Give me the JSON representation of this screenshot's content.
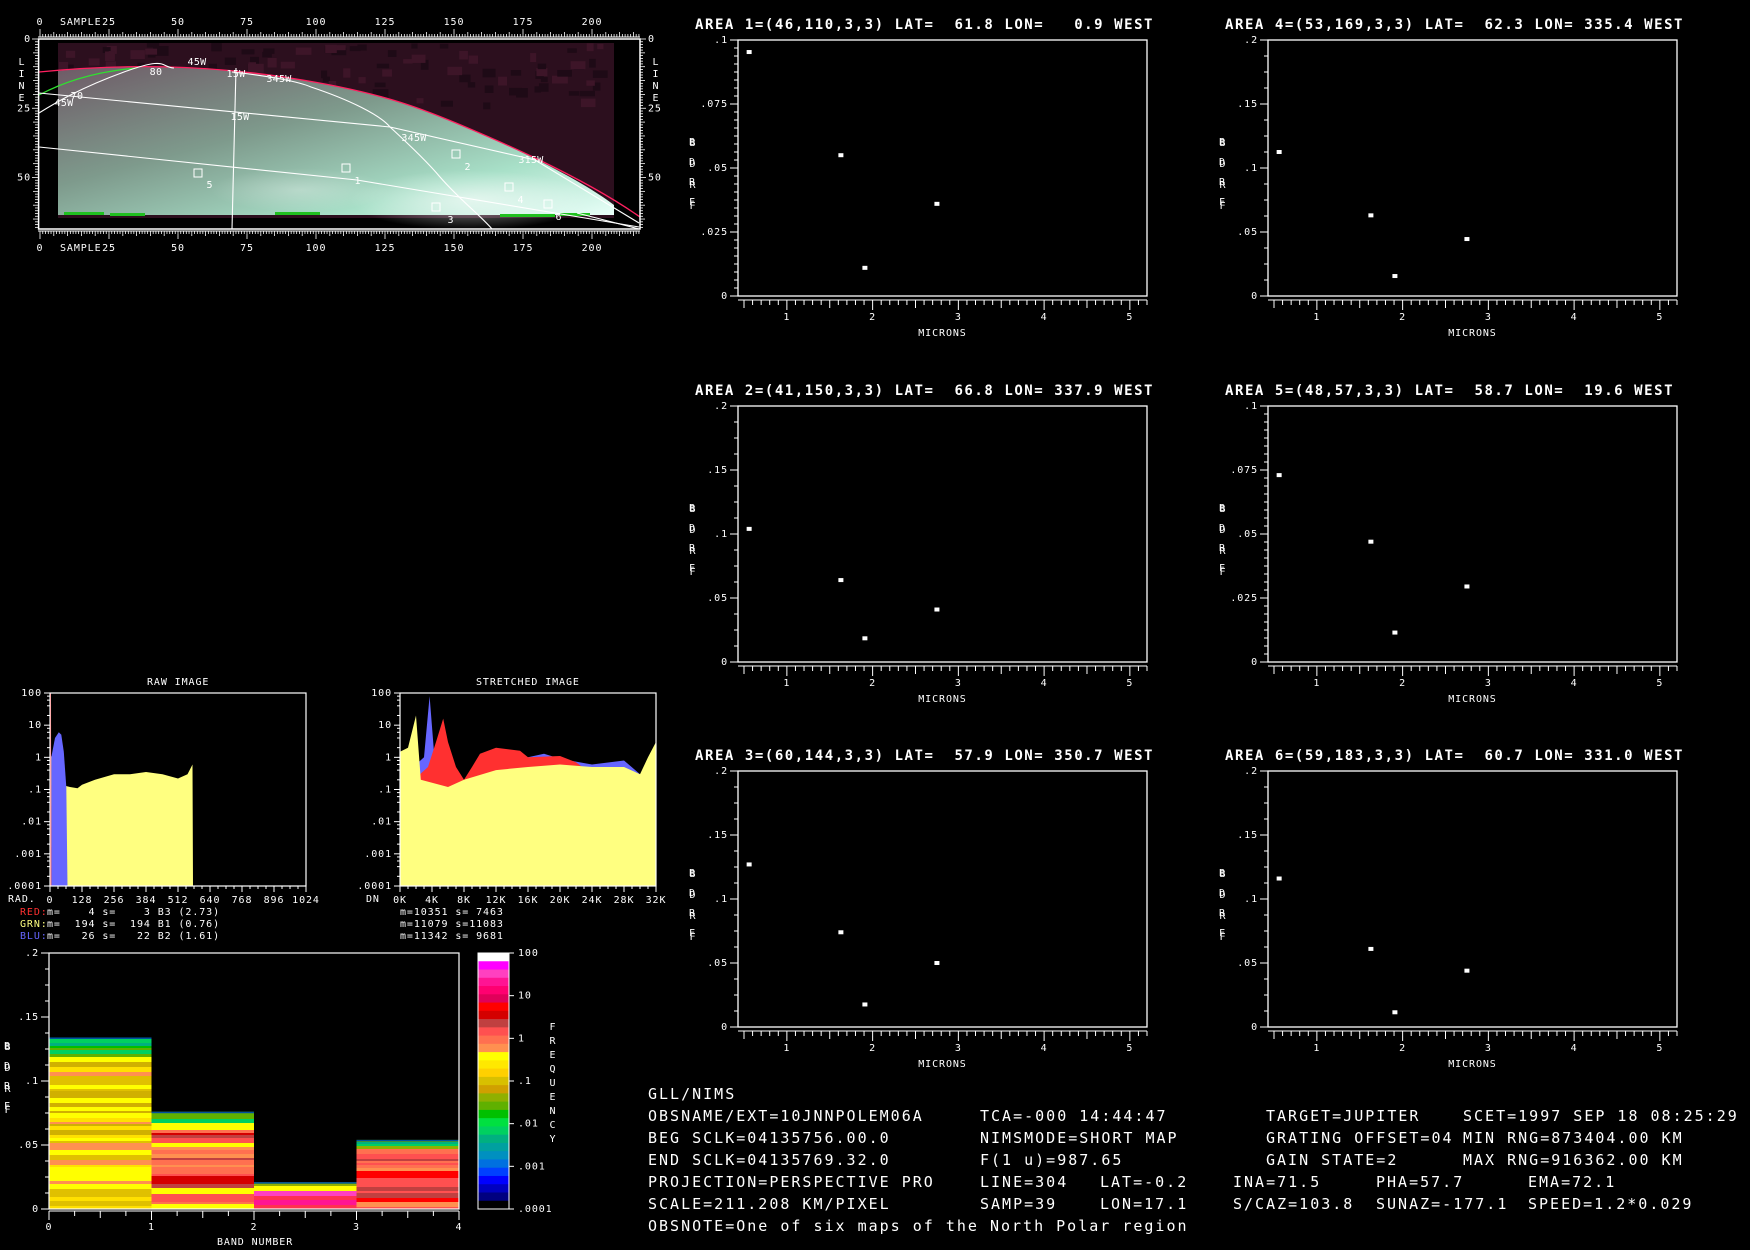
{
  "map": {
    "sample_axis_label": "SAMPLE",
    "line_axis_label": [
      "L",
      "I",
      "N",
      "E"
    ],
    "sample_ticks": [
      "0",
      "25",
      "50",
      "75",
      "100",
      "125",
      "150",
      "175",
      "200"
    ],
    "line_ticks": [
      "0",
      "25",
      "50"
    ],
    "grid_labels": [
      "80",
      "45W",
      "15W",
      "345W",
      "70",
      "45W",
      "15W",
      "345W",
      "315W"
    ],
    "area_labels": [
      "1",
      "2",
      "3",
      "4",
      "5",
      "6"
    ]
  },
  "histograms": {
    "raw": {
      "title": "RAW IMAGE",
      "x_unit": "RAD.",
      "xticks": [
        "0",
        "128",
        "256",
        "384",
        "512",
        "640",
        "768",
        "896",
        "1024"
      ],
      "yticks": [
        "100",
        "10",
        "1",
        ".1",
        ".01",
        ".001",
        ".0001"
      ],
      "stats": [
        {
          "label": "RED:",
          "text": "m=    4 s=    3 B3 (2.73)",
          "color": "#ff3030"
        },
        {
          "label": "GRN:",
          "text": "m=  194 s=  194 B1 (0.76)",
          "color": "#ffff80"
        },
        {
          "label": "BLU:",
          "text": "m=   26 s=   22 B2 (1.61)",
          "color": "#6666ff"
        }
      ]
    },
    "stretched": {
      "title": "STRETCHED IMAGE",
      "x_unit": "DN",
      "xticks": [
        "0K",
        "4K",
        "8K",
        "12K",
        "16K",
        "20K",
        "24K",
        "28K",
        "32K"
      ],
      "yticks": [
        "100",
        "10",
        "1",
        ".1",
        ".01",
        ".001",
        ".0001"
      ],
      "stats": [
        "m=10351 s= 7463",
        "m=11079 s=11083",
        "m=11342 s= 9681"
      ]
    }
  },
  "band_chart": {
    "yticks": [
      ".2",
      ".15",
      ".1",
      ".05",
      "0"
    ],
    "xticks": [
      "0",
      "1",
      "2",
      "3",
      "4"
    ],
    "xlabel": "BAND NUMBER",
    "ylabel": [
      "B",
      "D",
      "R",
      "F"
    ],
    "colorbar_ticks": [
      "100",
      "10",
      "1",
      ".1",
      ".01",
      ".001",
      ".0001"
    ],
    "colorbar_label": [
      "F",
      "R",
      "E",
      "Q",
      "U",
      "E",
      "N",
      "C",
      "Y"
    ]
  },
  "areas": [
    {
      "title": "AREA 1=(46,110,3,3) LAT=  61.8 LON=   0.9 WEST",
      "yticks": [
        ".1",
        ".075",
        ".05",
        ".025",
        "0"
      ]
    },
    {
      "title": "AREA 2=(41,150,3,3) LAT=  66.8 LON= 337.9 WEST",
      "yticks": [
        ".2",
        ".15",
        ".1",
        ".05",
        "0"
      ]
    },
    {
      "title": "AREA 3=(60,144,3,3) LAT=  57.9 LON= 350.7 WEST",
      "yticks": [
        ".2",
        ".15",
        ".1",
        ".05",
        "0"
      ]
    },
    {
      "title": "AREA 4=(53,169,3,3) LAT=  62.3 LON= 335.4 WEST",
      "yticks": [
        ".2",
        ".15",
        ".1",
        ".05",
        "0"
      ]
    },
    {
      "title": "AREA 5=(48,57,3,3) LAT=  58.7 LON=  19.6 WEST",
      "yticks": [
        ".1",
        ".075",
        ".05",
        ".025",
        "0"
      ]
    },
    {
      "title": "AREA 6=(59,183,3,3) LAT=  60.7 LON= 331.0 WEST",
      "yticks": [
        ".2",
        ".15",
        ".1",
        ".05",
        "0"
      ]
    }
  ],
  "area_axis": {
    "xlabel": "MICRONS",
    "ylabel": [
      "B",
      "D",
      "R",
      "F"
    ],
    "xticks": [
      "1",
      "2",
      "3",
      "4",
      "5"
    ]
  },
  "info": {
    "header": "GLL/NIMS",
    "obsname": "OBSNAME/EXT=10JNNPOLEM06A",
    "tca": "TCA=-000 14:44:47",
    "target": "TARGET=JUPITER",
    "scet": "SCET=1997 SEP 18 08:25:29",
    "beg_sclk": "BEG SCLK=04135756.00.0",
    "nimsmode": "NIMSMODE=SHORT MAP",
    "grating": "GRATING OFFSET=04",
    "min_rng": "MIN RNG=873404.00 KM",
    "end_sclk": "END SCLK=04135769.32.0",
    "f1u": "F(1 u)=987.65",
    "gain": "GAIN STATE=2",
    "max_rng": "MAX RNG=916362.00 KM",
    "projection": "PROJECTION=PERSPECTIVE PRO",
    "line": "LINE=304",
    "lat": "LAT=-0.2",
    "ina": "INA=71.5",
    "pha": "PHA=57.7",
    "ema": "EMA=72.1",
    "scale": "SCALE=211.208 KM/PIXEL",
    "samp": "SAMP=39",
    "lon": "LON=17.1",
    "scaz": "S/CAZ=103.8",
    "sunaz": "SUNAZ=-177.1",
    "speed": "SPEED=1.2*0.029",
    "obsnote": "OBSNOTE=One of six maps of the North Polar region"
  },
  "colors": {
    "red": "#ff3030",
    "yellow": "#ffff80",
    "blue": "#6666ff",
    "limb": "#ff2060",
    "terminator": "#30e030"
  },
  "chart_data": [
    {
      "type": "scatter",
      "title": "AREA 1=(46,110,3,3) LAT=  61.8 LON=   0.9 WEST",
      "xlabel": "MICRONS",
      "ylabel": "BDRF",
      "xlim": [
        0.43,
        5.2
      ],
      "ylim": [
        0,
        0.1
      ],
      "x": [
        0.56,
        1.63,
        1.91,
        2.75
      ],
      "y": [
        0.0953,
        0.055,
        0.011,
        0.036
      ]
    },
    {
      "type": "scatter",
      "title": "AREA 2=(41,150,3,3) LAT=  66.8 LON= 337.9 WEST",
      "xlabel": "MICRONS",
      "ylabel": "BDRF",
      "xlim": [
        0.43,
        5.2
      ],
      "ylim": [
        0,
        0.2
      ],
      "x": [
        0.56,
        1.63,
        1.91,
        2.75
      ],
      "y": [
        0.104,
        0.064,
        0.0185,
        0.041
      ]
    },
    {
      "type": "scatter",
      "title": "AREA 3=(60,144,3,3) LAT=  57.9 LON= 350.7 WEST",
      "xlabel": "MICRONS",
      "ylabel": "BDRF",
      "xlim": [
        0.43,
        5.2
      ],
      "ylim": [
        0,
        0.2
      ],
      "x": [
        0.56,
        1.63,
        1.91,
        2.75
      ],
      "y": [
        0.127,
        0.074,
        0.0176,
        0.05
      ]
    },
    {
      "type": "scatter",
      "title": "AREA 4=(53,169,3,3) LAT=  62.3 LON= 335.4 WEST",
      "xlabel": "MICRONS",
      "ylabel": "BDRF",
      "xlim": [
        0.43,
        5.2
      ],
      "ylim": [
        0,
        0.2
      ],
      "x": [
        0.56,
        1.63,
        1.91,
        2.75
      ],
      "y": [
        0.1125,
        0.063,
        0.0156,
        0.0445
      ]
    },
    {
      "type": "scatter",
      "title": "AREA 5=(48,57,3,3) LAT=  58.7 LON=  19.6 WEST",
      "xlabel": "MICRONS",
      "ylabel": "BDRF",
      "xlim": [
        0.43,
        5.2
      ],
      "ylim": [
        0,
        0.1
      ],
      "x": [
        0.56,
        1.63,
        1.91,
        2.75
      ],
      "y": [
        0.073,
        0.047,
        0.0115,
        0.0295
      ]
    },
    {
      "type": "scatter",
      "title": "AREA 6=(59,183,3,3) LAT=  60.7 LON= 331.0 WEST",
      "xlabel": "MICRONS",
      "ylabel": "BDRF",
      "xlim": [
        0.43,
        5.2
      ],
      "ylim": [
        0,
        0.2
      ],
      "x": [
        0.56,
        1.63,
        1.91,
        2.75
      ],
      "y": [
        0.116,
        0.061,
        0.0115,
        0.044
      ]
    },
    {
      "type": "area",
      "title": "RAW IMAGE",
      "xlabel": "RAD.",
      "yscale": "log",
      "xlim": [
        0,
        1024
      ],
      "ylim": [
        0.0001,
        100
      ],
      "series": [
        {
          "name": "GRN",
          "color": "#ffff80",
          "points": [
            [
              0,
              1
            ],
            [
              15,
              1.2
            ],
            [
              30,
              1
            ],
            [
              45,
              0.6
            ],
            [
              60,
              0.13
            ],
            [
              80,
              0.12
            ],
            [
              110,
              0.11
            ],
            [
              128,
              0.14
            ],
            [
              180,
              0.2
            ],
            [
              256,
              0.3
            ],
            [
              320,
              0.3
            ],
            [
              384,
              0.35
            ],
            [
              450,
              0.3
            ],
            [
              512,
              0.22
            ],
            [
              550,
              0.3
            ],
            [
              570,
              0.6
            ],
            [
              572,
              0
            ]
          ]
        },
        {
          "name": "BLU",
          "color": "#6666ff",
          "points": [
            [
              5,
              1
            ],
            [
              20,
              4
            ],
            [
              35,
              6
            ],
            [
              45,
              5
            ],
            [
              55,
              1.5
            ],
            [
              65,
              0.12
            ],
            [
              70,
              0
            ]
          ]
        },
        {
          "name": "RED",
          "color": "#ff3030",
          "points": [
            [
              0,
              100
            ],
            [
              4,
              100
            ],
            [
              5,
              0
            ]
          ]
        }
      ]
    },
    {
      "type": "area",
      "title": "STRETCHED IMAGE",
      "xlabel": "DN",
      "yscale": "log",
      "xlim": [
        0,
        32
      ],
      "ylim": [
        0.0001,
        100
      ],
      "series": [
        {
          "name": "BLU",
          "color": "#6666ff",
          "points": [
            [
              0,
              0.5
            ],
            [
              2,
              0.6
            ],
            [
              3,
              1
            ],
            [
              3.7,
              80
            ],
            [
              4.3,
              1
            ],
            [
              6,
              0.2
            ],
            [
              8,
              0.2
            ],
            [
              10,
              0.5
            ],
            [
              12,
              0.8
            ],
            [
              16,
              1
            ],
            [
              18,
              1.3
            ],
            [
              20,
              0.9
            ],
            [
              24,
              0.6
            ],
            [
              28,
              0.8
            ],
            [
              30,
              0.3
            ],
            [
              31,
              0.04
            ],
            [
              32,
              0.03
            ]
          ]
        },
        {
          "name": "RED",
          "color": "#ff3030",
          "points": [
            [
              0,
              0.2
            ],
            [
              2.5,
              0.3
            ],
            [
              3.5,
              0.5
            ],
            [
              4.5,
              3
            ],
            [
              5.4,
              16
            ],
            [
              6,
              3
            ],
            [
              7,
              0.5
            ],
            [
              8,
              0.2
            ],
            [
              9,
              0.5
            ],
            [
              10,
              1.3
            ],
            [
              12,
              2
            ],
            [
              15,
              1.6
            ],
            [
              16,
              1
            ],
            [
              20,
              1.1
            ],
            [
              22,
              0.7
            ],
            [
              24,
              0.3
            ],
            [
              26,
              0.05
            ],
            [
              28,
              0.01
            ],
            [
              30,
              0.002
            ],
            [
              32,
              0.0005
            ]
          ]
        },
        {
          "name": "GRN",
          "color": "#ffff80",
          "points": [
            [
              0,
              1.5
            ],
            [
              1,
              2
            ],
            [
              2,
              20
            ],
            [
              2.6,
              0.2
            ],
            [
              6,
              0.12
            ],
            [
              8,
              0.2
            ],
            [
              12,
              0.4
            ],
            [
              16,
              0.5
            ],
            [
              20,
              0.6
            ],
            [
              24,
              0.5
            ],
            [
              28,
              0.5
            ],
            [
              30,
              0.3
            ],
            [
              31,
              1
            ],
            [
              32,
              3
            ]
          ]
        }
      ]
    },
    {
      "type": "heatmap",
      "title": "BDRF vs BAND NUMBER",
      "xlabel": "BAND NUMBER",
      "ylabel": "BDRF",
      "xlim": [
        0,
        4
      ],
      "ylim": [
        0,
        0.2
      ],
      "bands": [
        {
          "range": [
            0,
            1
          ],
          "max_bdrf": 0.134
        },
        {
          "range": [
            1,
            2
          ],
          "max_bdrf": 0.076
        },
        {
          "range": [
            2,
            3
          ],
          "max_bdrf": 0.021
        },
        {
          "range": [
            3,
            4
          ],
          "max_bdrf": 0.054
        }
      ],
      "colorbar": {
        "label": "FREQUENCY",
        "scale": "log",
        "range": [
          0.0001,
          100
        ]
      }
    }
  ]
}
